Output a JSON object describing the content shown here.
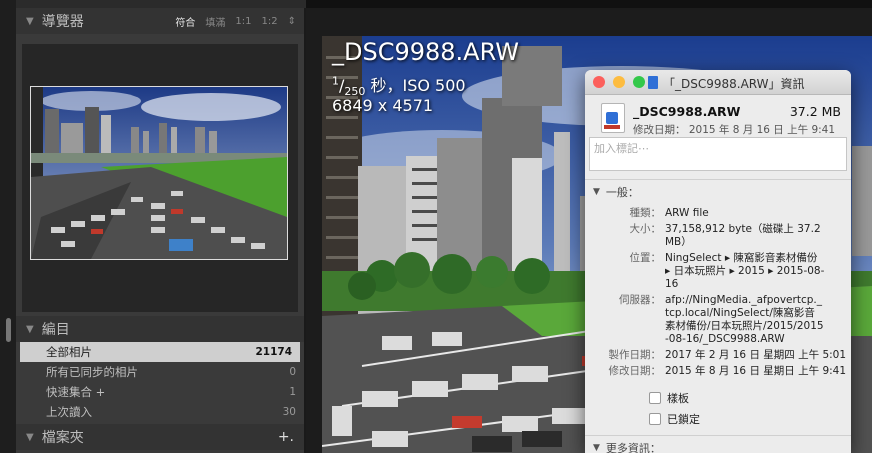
{
  "left_panel": {
    "navigator": {
      "title": "導覽器",
      "options": [
        "符合",
        "填滿",
        "1:1",
        "1:2"
      ],
      "stepper_symbol": "⇕"
    },
    "catalog": {
      "title": "編目",
      "items": [
        {
          "label": "全部相片",
          "count": "21174"
        },
        {
          "label": "所有已同步的相片",
          "count": "0"
        },
        {
          "label": "快速集合 +",
          "count": "1"
        },
        {
          "label": "上次讀入",
          "count": "30"
        }
      ]
    },
    "folders": {
      "title": "檔案夾",
      "add_symbol": "+."
    }
  },
  "loupe_overlay": {
    "filename": "_DSC9988.ARW",
    "exposure_numerator": "1",
    "exposure_denominator": "250",
    "exposure_rest": " 秒，ISO 500",
    "dimensions": "6849 x 4571"
  },
  "info_window": {
    "title": "「_DSC9988.ARW」資訊",
    "file_name": "_DSC9988.ARW",
    "file_size": "37.2 MB",
    "modified_summary": "修改日期： 2015 年 8 月 16 日 上午 9:41",
    "tags_placeholder": "加入標記⋯",
    "general": {
      "header": "一般：",
      "rows": [
        {
          "label": "種類：",
          "value": "ARW file"
        },
        {
          "label": "大小：",
          "value": "37,158,912 byte（磁碟上 37.2 MB）"
        },
        {
          "label": "位置：",
          "value": "NingSelect ▸ 陳窩影音素材備份 ▸ 日本玩照片 ▸ 2015 ▸ 2015-08-16"
        },
        {
          "label": "伺服器：",
          "value": "afp://NingMedia._afpovertcp._tcp.local/NingSelect/陳窩影音素材備份/日本玩照片/2015/2015-08-16/_DSC9988.ARW"
        },
        {
          "label": "製作日期：",
          "value": "2017 年 2 月 16 日 星期四 上午 5:01"
        },
        {
          "label": "修改日期：",
          "value": "2015 年 8 月 16 日 星期日 上午 9:41"
        }
      ],
      "checkboxes": [
        {
          "label": "樣板",
          "checked": false
        },
        {
          "label": "已鎖定",
          "checked": false
        }
      ]
    },
    "more_info": {
      "header": "更多資訊："
    }
  },
  "colors": {
    "panel_bg": "#3a3a3a",
    "selected_row": "#cfcfcf",
    "close": "#fc605c",
    "minimize": "#fdbc40",
    "zoom": "#34c84a",
    "window_bg": "#ececec"
  }
}
